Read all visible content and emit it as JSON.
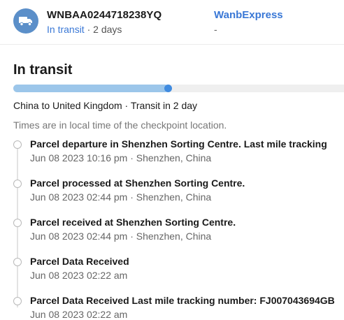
{
  "header": {
    "tracking_number": "WNBAA0244718238YQ",
    "status": "In transit",
    "status_suffix": " · 2 days",
    "carrier_name": "WanbExpress",
    "carrier_sub": "-",
    "icon": "truck-icon",
    "accent_color": "#3a78d6"
  },
  "summary": {
    "status_title": "In transit",
    "progress_fraction": 0.47,
    "route": "China to United Kingdom · Transit in 2 day",
    "note": "Times are in local time of the checkpoint location."
  },
  "events": [
    {
      "title": "Parcel departure in Shenzhen Sorting Centre. Last mile tracking",
      "meta": "Jun 08 2023 10:16 pm · Shenzhen, China"
    },
    {
      "title": "Parcel processed at Shenzhen Sorting Centre.",
      "meta": "Jun 08 2023 02:44 pm · Shenzhen, China"
    },
    {
      "title": "Parcel received at Shenzhen Sorting Centre.",
      "meta": "Jun 08 2023 02:44 pm · Shenzhen, China"
    },
    {
      "title": "Parcel Data Received",
      "meta": "Jun 08 2023 02:22 am"
    },
    {
      "title": "Parcel Data Received Last mile tracking number: FJ007043694GB",
      "meta": "Jun 08 2023 02:22 am"
    }
  ]
}
